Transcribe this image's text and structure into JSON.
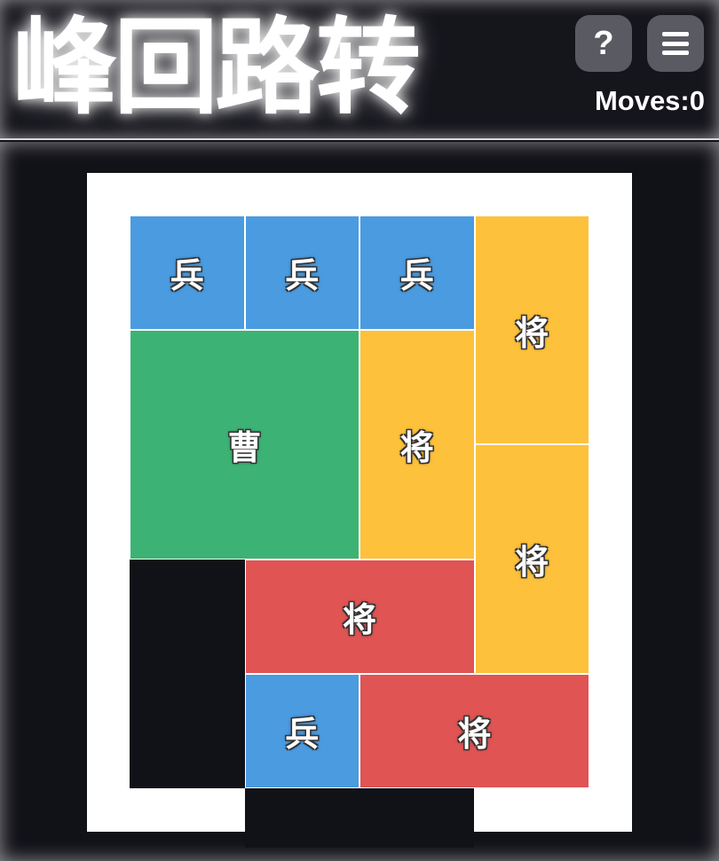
{
  "header": {
    "title": "峰回路转",
    "help_label": "?",
    "moves_label": "Moves:",
    "moves_value": "0"
  },
  "icons": {
    "help": "help-icon",
    "menu": "hamburger-menu-icon"
  },
  "colors": {
    "soldier": "#4a9be0",
    "cao": "#3cb374",
    "general_vertical": "#fdc13c",
    "general_horizontal": "#e05454",
    "empty": "#111118",
    "frame": "#ffffff"
  },
  "board": {
    "cols": 4,
    "rows": 5,
    "pieces": [
      {
        "label": "兵",
        "type": "soldier",
        "col": 0,
        "row": 0,
        "w": 1,
        "h": 1
      },
      {
        "label": "兵",
        "type": "soldier",
        "col": 1,
        "row": 0,
        "w": 1,
        "h": 1
      },
      {
        "label": "兵",
        "type": "soldier",
        "col": 2,
        "row": 0,
        "w": 1,
        "h": 1
      },
      {
        "label": "将",
        "type": "general_vertical",
        "col": 3,
        "row": 0,
        "w": 1,
        "h": 2
      },
      {
        "label": "曹",
        "type": "cao",
        "col": 0,
        "row": 1,
        "w": 2,
        "h": 2
      },
      {
        "label": "将",
        "type": "general_vertical",
        "col": 2,
        "row": 1,
        "w": 1,
        "h": 2
      },
      {
        "label": "将",
        "type": "general_vertical",
        "col": 3,
        "row": 2,
        "w": 1,
        "h": 2
      },
      {
        "label": "将",
        "type": "general_horizontal",
        "col": 1,
        "row": 3,
        "w": 2,
        "h": 1
      },
      {
        "label": "兵",
        "type": "soldier",
        "col": 1,
        "row": 4,
        "w": 1,
        "h": 1
      },
      {
        "label": "将",
        "type": "general_horizontal",
        "col": 2,
        "row": 4,
        "w": 2,
        "h": 1
      }
    ]
  }
}
